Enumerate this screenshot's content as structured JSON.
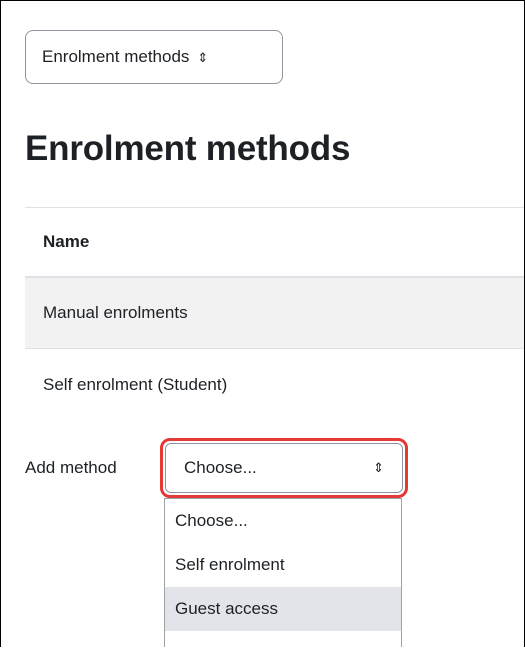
{
  "jump_menu": {
    "label": "Enrolment methods",
    "chevron": "⇕"
  },
  "page": {
    "title": "Enrolment methods"
  },
  "table": {
    "header": "Name",
    "rows": [
      "Manual enrolments",
      "Self enrolment (Student)"
    ]
  },
  "add_method": {
    "label": "Add method",
    "selected": "Choose...",
    "chevron": "⇕",
    "options": [
      "Choose...",
      "Self enrolment",
      "Guest access"
    ],
    "highlighted_option": "Guest access"
  },
  "colors": {
    "highlight_outline": "#e53935",
    "row_stripe": "#f2f2f2",
    "option_hover": "#e3e4ea"
  }
}
